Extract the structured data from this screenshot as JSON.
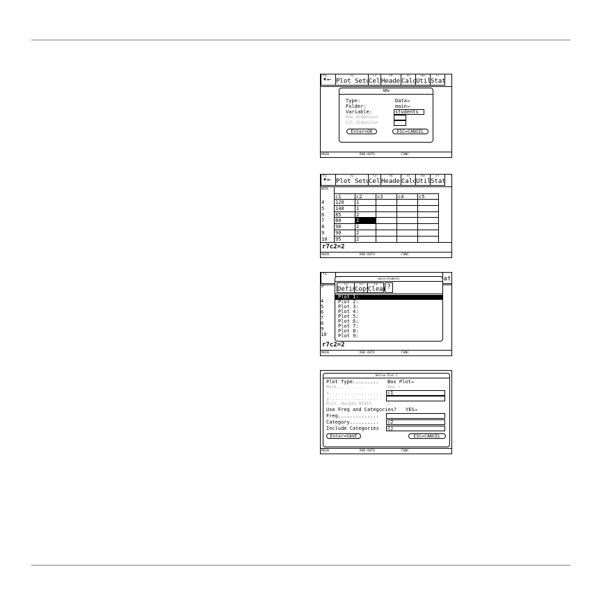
{
  "status": {
    "mode": "MAIN",
    "angle": "RAD AUTO",
    "graph": "FUNC"
  },
  "screen1": {
    "tabs": [
      {
        "key": "F1",
        "label": "▾←"
      },
      {
        "key": "F2",
        "label": "Plot Setup"
      },
      {
        "key": "F3",
        "label": "Cell"
      },
      {
        "key": "F4",
        "label": "Header"
      },
      {
        "key": "F5",
        "label": "Calc"
      },
      {
        "key": "F6▾",
        "label": "Util"
      },
      {
        "key": "F7",
        "label": "Stat"
      }
    ],
    "dialog_title": "NEW",
    "type_label": "Type:",
    "type_value": "Data→",
    "folder_label": "Folder:",
    "folder_value": "main→",
    "variable_label": "Variable:",
    "variable_value": "students",
    "row_dim_label": "Row dimension",
    "row_dim_value": "",
    "col_dim_label": "Col dimension",
    "col_dim_value": "",
    "ok_button": "Enter=OK",
    "cancel_button": "ESC=CANCEL"
  },
  "screen2": {
    "tabs": [
      {
        "key": "F1",
        "label": "▾←"
      },
      {
        "key": "F2",
        "label": "Plot Setup"
      },
      {
        "key": "F3",
        "label": "Cell"
      },
      {
        "key": "F4",
        "label": "Header"
      },
      {
        "key": "F5",
        "label": "Calc"
      },
      {
        "key": "F6▾",
        "label": "Util"
      },
      {
        "key": "F7",
        "label": "Stat"
      }
    ],
    "data_label": "DATA",
    "columns": [
      "c1",
      "c2",
      "c3",
      "c4",
      "c5"
    ],
    "rows": [
      {
        "n": "4",
        "c1": "120",
        "c2": "1"
      },
      {
        "n": "5",
        "c1": "140",
        "c2": "1"
      },
      {
        "n": "6",
        "c1": "85",
        "c2": "2"
      },
      {
        "n": "7",
        "c1": "80",
        "c2": "2"
      },
      {
        "n": "8",
        "c1": "90",
        "c2": "2"
      },
      {
        "n": "9",
        "c1": "90",
        "c2": "2"
      },
      {
        "n": "10",
        "c1": "95",
        "c2": "2"
      }
    ],
    "entry_line": "r7c2=2"
  },
  "screen3": {
    "title": "main\\students",
    "tabs": [
      {
        "key": "F1",
        "label": "Define"
      },
      {
        "key": "F2",
        "label": "Copy"
      },
      {
        "key": "F3",
        "label": "Clear"
      },
      {
        "key": "",
        "label": "?"
      }
    ],
    "plots": [
      "Plot 1:",
      "Plot 2:",
      "Plot 3:",
      "Plot 4:",
      "Plot 5:",
      "Plot 6:",
      "Plot 7:",
      "Plot 8:",
      "Plot 9:"
    ],
    "row_numbers": [
      "4",
      "5",
      "6",
      "7",
      "8",
      "9",
      "10"
    ],
    "entry_line": "r7c2=2",
    "underlying_first_tab_key": "F1",
    "underlying_last_tab": "at"
  },
  "screen4": {
    "title": "Define Plot 1",
    "plot_type_label": "Plot Type.........",
    "plot_type_value": "Box Plot→",
    "mark_label": "Mark...........",
    "mark_value": "Box →",
    "x_label": "x..................",
    "x_value": "c1",
    "y_label": "y..................",
    "y_value": "",
    "hist_label": "Hist. Bucket Width",
    "hist_value": "1",
    "freq_cat_label": "Use Freq and Categories?",
    "freq_cat_value": "YES→",
    "freq_label": "Freq..............",
    "freq_value": "",
    "category_label": "Category..........",
    "category_value": "c2",
    "include_label": "Include Categories",
    "include_value": "{}",
    "save_button": "Enter=SAVE",
    "cancel_button": "ESC=CANCEL"
  }
}
